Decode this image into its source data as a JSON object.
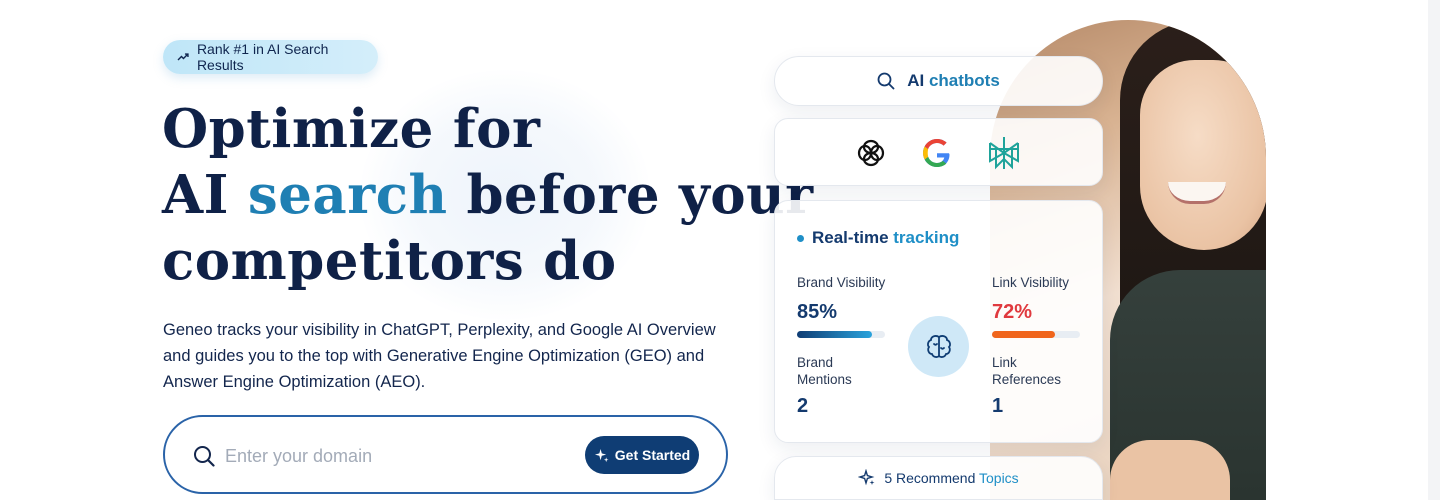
{
  "hero": {
    "badge_label": "Rank #1 in AI Search Results",
    "headline": {
      "line1": "Optimize for",
      "line2_prefix": "AI",
      "line2_accent": "search",
      "line2_suffix": "before your",
      "line3": "competitors do"
    },
    "description": "Geneo tracks your visibility in ChatGPT, Perplexity, and Google AI Overview and guides you to the top with Generative Engine Optimization (GEO) and Answer Engine Optimization (AEO).",
    "search": {
      "placeholder": "Enter your domain",
      "value": "",
      "button_label": "Get Started"
    }
  },
  "showcase": {
    "chatbots_card": {
      "label_prefix": "AI",
      "label_accent": "chatbots"
    },
    "logos": [
      "chatgpt-icon",
      "google-icon",
      "perplexity-icon"
    ],
    "tracking_card": {
      "title_prefix": "Real-time",
      "title_accent": "tracking",
      "brand_visibility": {
        "label": "Brand Visibility",
        "value": "85%",
        "fraction": 0.85,
        "color": "#1f8fc7"
      },
      "link_visibility": {
        "label": "Link Visibility",
        "value": "72%",
        "fraction": 0.72,
        "color": "#f0651c"
      },
      "brand_mentions": {
        "label_line1": "Brand",
        "label_line2": "Mentions",
        "value": "2"
      },
      "link_references": {
        "label_line1": "Link",
        "label_line2": "References",
        "value": "1"
      }
    },
    "topics_card": {
      "label_prefix": "5 Recommend",
      "label_accent": "Topics"
    }
  },
  "colors": {
    "navy": "#0f2147",
    "accent_blue": "#1f7fb3",
    "button": "#0f3d74",
    "link_visibility_red": "#e0393e"
  }
}
